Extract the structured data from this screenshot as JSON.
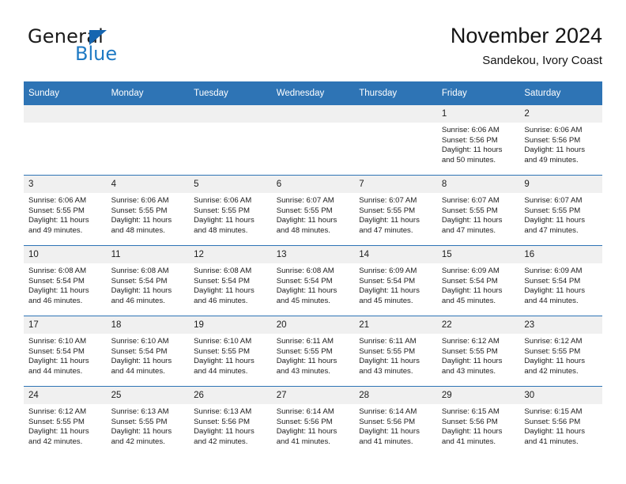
{
  "brand": {
    "name_top": "General",
    "name_bottom": "Blue",
    "accent_color": "#1f7ac4",
    "triangle_color": "#1565b0"
  },
  "header": {
    "title": "November 2024",
    "subtitle": "Sandekou, Ivory Coast"
  },
  "calendar": {
    "header_color": "#2e74b5",
    "daynum_band_color": "#f0f0f0",
    "weekdays": [
      "Sunday",
      "Monday",
      "Tuesday",
      "Wednesday",
      "Thursday",
      "Friday",
      "Saturday"
    ],
    "weeks": [
      [
        {
          "day": "",
          "empty": true
        },
        {
          "day": "",
          "empty": true
        },
        {
          "day": "",
          "empty": true
        },
        {
          "day": "",
          "empty": true
        },
        {
          "day": "",
          "empty": true
        },
        {
          "day": "1",
          "sunrise": "Sunrise: 6:06 AM",
          "sunset": "Sunset: 5:56 PM",
          "daylight": "Daylight: 11 hours and 50 minutes."
        },
        {
          "day": "2",
          "sunrise": "Sunrise: 6:06 AM",
          "sunset": "Sunset: 5:56 PM",
          "daylight": "Daylight: 11 hours and 49 minutes."
        }
      ],
      [
        {
          "day": "3",
          "sunrise": "Sunrise: 6:06 AM",
          "sunset": "Sunset: 5:55 PM",
          "daylight": "Daylight: 11 hours and 49 minutes."
        },
        {
          "day": "4",
          "sunrise": "Sunrise: 6:06 AM",
          "sunset": "Sunset: 5:55 PM",
          "daylight": "Daylight: 11 hours and 48 minutes."
        },
        {
          "day": "5",
          "sunrise": "Sunrise: 6:06 AM",
          "sunset": "Sunset: 5:55 PM",
          "daylight": "Daylight: 11 hours and 48 minutes."
        },
        {
          "day": "6",
          "sunrise": "Sunrise: 6:07 AM",
          "sunset": "Sunset: 5:55 PM",
          "daylight": "Daylight: 11 hours and 48 minutes."
        },
        {
          "day": "7",
          "sunrise": "Sunrise: 6:07 AM",
          "sunset": "Sunset: 5:55 PM",
          "daylight": "Daylight: 11 hours and 47 minutes."
        },
        {
          "day": "8",
          "sunrise": "Sunrise: 6:07 AM",
          "sunset": "Sunset: 5:55 PM",
          "daylight": "Daylight: 11 hours and 47 minutes."
        },
        {
          "day": "9",
          "sunrise": "Sunrise: 6:07 AM",
          "sunset": "Sunset: 5:55 PM",
          "daylight": "Daylight: 11 hours and 47 minutes."
        }
      ],
      [
        {
          "day": "10",
          "sunrise": "Sunrise: 6:08 AM",
          "sunset": "Sunset: 5:54 PM",
          "daylight": "Daylight: 11 hours and 46 minutes."
        },
        {
          "day": "11",
          "sunrise": "Sunrise: 6:08 AM",
          "sunset": "Sunset: 5:54 PM",
          "daylight": "Daylight: 11 hours and 46 minutes."
        },
        {
          "day": "12",
          "sunrise": "Sunrise: 6:08 AM",
          "sunset": "Sunset: 5:54 PM",
          "daylight": "Daylight: 11 hours and 46 minutes."
        },
        {
          "day": "13",
          "sunrise": "Sunrise: 6:08 AM",
          "sunset": "Sunset: 5:54 PM",
          "daylight": "Daylight: 11 hours and 45 minutes."
        },
        {
          "day": "14",
          "sunrise": "Sunrise: 6:09 AM",
          "sunset": "Sunset: 5:54 PM",
          "daylight": "Daylight: 11 hours and 45 minutes."
        },
        {
          "day": "15",
          "sunrise": "Sunrise: 6:09 AM",
          "sunset": "Sunset: 5:54 PM",
          "daylight": "Daylight: 11 hours and 45 minutes."
        },
        {
          "day": "16",
          "sunrise": "Sunrise: 6:09 AM",
          "sunset": "Sunset: 5:54 PM",
          "daylight": "Daylight: 11 hours and 44 minutes."
        }
      ],
      [
        {
          "day": "17",
          "sunrise": "Sunrise: 6:10 AM",
          "sunset": "Sunset: 5:54 PM",
          "daylight": "Daylight: 11 hours and 44 minutes."
        },
        {
          "day": "18",
          "sunrise": "Sunrise: 6:10 AM",
          "sunset": "Sunset: 5:54 PM",
          "daylight": "Daylight: 11 hours and 44 minutes."
        },
        {
          "day": "19",
          "sunrise": "Sunrise: 6:10 AM",
          "sunset": "Sunset: 5:55 PM",
          "daylight": "Daylight: 11 hours and 44 minutes."
        },
        {
          "day": "20",
          "sunrise": "Sunrise: 6:11 AM",
          "sunset": "Sunset: 5:55 PM",
          "daylight": "Daylight: 11 hours and 43 minutes."
        },
        {
          "day": "21",
          "sunrise": "Sunrise: 6:11 AM",
          "sunset": "Sunset: 5:55 PM",
          "daylight": "Daylight: 11 hours and 43 minutes."
        },
        {
          "day": "22",
          "sunrise": "Sunrise: 6:12 AM",
          "sunset": "Sunset: 5:55 PM",
          "daylight": "Daylight: 11 hours and 43 minutes."
        },
        {
          "day": "23",
          "sunrise": "Sunrise: 6:12 AM",
          "sunset": "Sunset: 5:55 PM",
          "daylight": "Daylight: 11 hours and 42 minutes."
        }
      ],
      [
        {
          "day": "24",
          "sunrise": "Sunrise: 6:12 AM",
          "sunset": "Sunset: 5:55 PM",
          "daylight": "Daylight: 11 hours and 42 minutes."
        },
        {
          "day": "25",
          "sunrise": "Sunrise: 6:13 AM",
          "sunset": "Sunset: 5:55 PM",
          "daylight": "Daylight: 11 hours and 42 minutes."
        },
        {
          "day": "26",
          "sunrise": "Sunrise: 6:13 AM",
          "sunset": "Sunset: 5:56 PM",
          "daylight": "Daylight: 11 hours and 42 minutes."
        },
        {
          "day": "27",
          "sunrise": "Sunrise: 6:14 AM",
          "sunset": "Sunset: 5:56 PM",
          "daylight": "Daylight: 11 hours and 41 minutes."
        },
        {
          "day": "28",
          "sunrise": "Sunrise: 6:14 AM",
          "sunset": "Sunset: 5:56 PM",
          "daylight": "Daylight: 11 hours and 41 minutes."
        },
        {
          "day": "29",
          "sunrise": "Sunrise: 6:15 AM",
          "sunset": "Sunset: 5:56 PM",
          "daylight": "Daylight: 11 hours and 41 minutes."
        },
        {
          "day": "30",
          "sunrise": "Sunrise: 6:15 AM",
          "sunset": "Sunset: 5:56 PM",
          "daylight": "Daylight: 11 hours and 41 minutes."
        }
      ]
    ]
  }
}
